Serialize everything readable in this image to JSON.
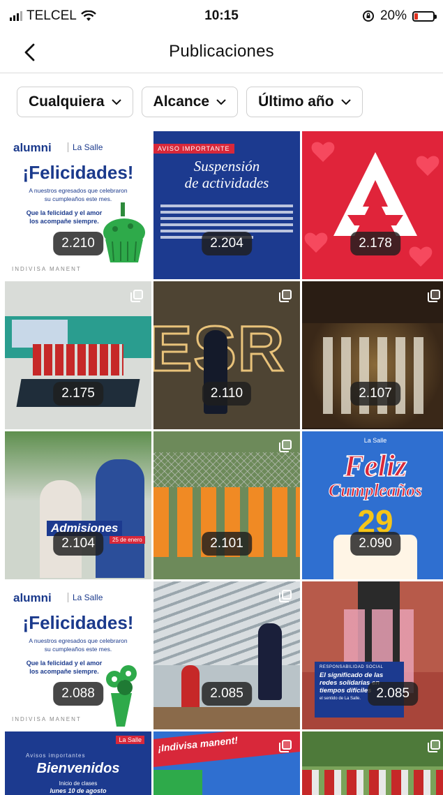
{
  "status_bar": {
    "carrier": "TELCEL",
    "time": "10:15",
    "battery": "20%",
    "battery_level": 0.2
  },
  "navbar": {
    "title": "Publicaciones"
  },
  "filters": [
    {
      "label": "Cualquiera"
    },
    {
      "label": "Alcance"
    },
    {
      "label": "Último año"
    }
  ],
  "posts": [
    {
      "count": "2.210",
      "alumni": "alumni",
      "school": "La Salle",
      "headline": "¡Felicidades!",
      "line1": "A nuestros egresados que celebraron",
      "line2": "su cumpleaños este mes.",
      "line3": "Que la felicidad y el amor",
      "line4": "los acompañe siempre.",
      "footer": "INDIVISA MANENT"
    },
    {
      "count": "2.204",
      "tag": "AVISO IMPORTANTE",
      "headline1": "Suspensión",
      "headline2": "de actividades"
    },
    {
      "count": "2.178"
    },
    {
      "count": "2.175"
    },
    {
      "count": "2.110"
    },
    {
      "count": "2.107"
    },
    {
      "count": "2.104",
      "headline": "Admisiones",
      "date": "25 de enero"
    },
    {
      "count": "2.101"
    },
    {
      "count": "2.090",
      "school": "La Salle",
      "headline1": "Feliz",
      "headline2": "Cumpleaños",
      "number": "29"
    },
    {
      "count": "2.088",
      "alumni": "alumni",
      "school": "La Salle",
      "headline": "¡Felicidades!",
      "line1": "A nuestros egresados que celebraron",
      "line2": "su cumpleaños este mes.",
      "line3": "Que la felicidad y el amor",
      "line4": "los acompañe siempre.",
      "footer": "INDIVISA MANENT"
    },
    {
      "count": "2.085"
    },
    {
      "count": "2.085",
      "tag": "RESPONSABILIDAD SOCIAL",
      "headline": "El significado de las redes solidarias en tiempos difíciles",
      "byline": "el sentido de La Salle."
    },
    {
      "school": "La Salle",
      "tag": "Avisos importantes",
      "headline": "Bienvenidos",
      "line1": "Inicio de clases",
      "line2": "lunes 10 de agosto"
    },
    {
      "text": "¡Indivisa manent!"
    },
    {}
  ]
}
